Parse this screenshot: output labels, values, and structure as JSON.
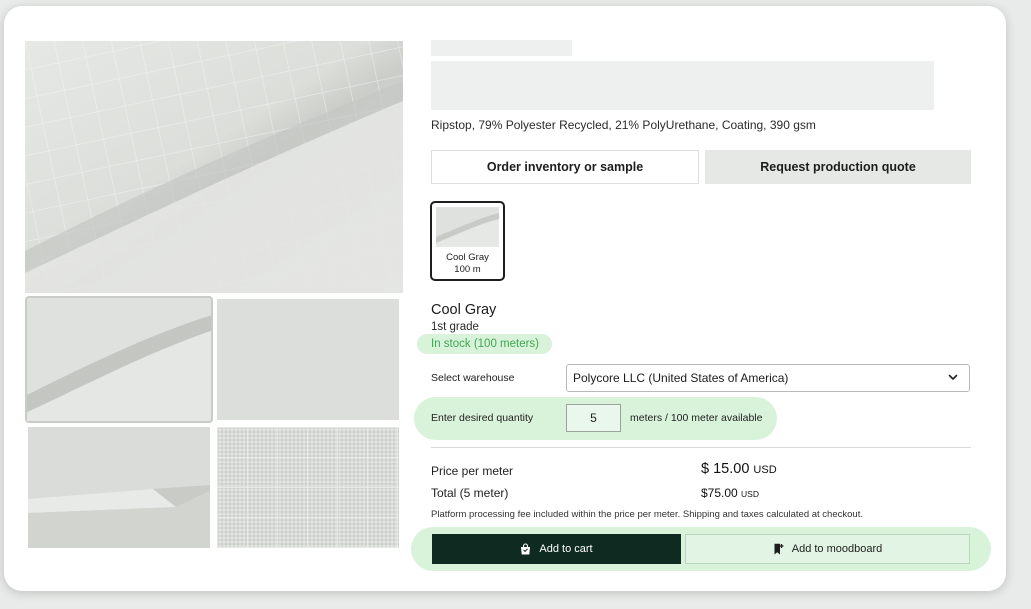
{
  "product": {
    "description": "Ripstop, 79% Polyester Recycled, 21% PolyUrethane, Coating, 390 gsm"
  },
  "tabs": {
    "order_label": "Order inventory or sample",
    "quote_label": "Request production quote"
  },
  "swatch": {
    "name": "Cool Gray",
    "quantity": "100 m",
    "icon": "fabric-swatch"
  },
  "variant": {
    "color_name": "Cool Gray",
    "grade": "1st grade",
    "stock_status": "In stock (100 meters)"
  },
  "warehouse": {
    "label": "Select warehouse",
    "selected": "Polycore LLC (United States of America)",
    "icon": "chevron-down-icon"
  },
  "quantity": {
    "label": "Enter desired quantity",
    "value": "5",
    "availability": "meters / 100 meter available"
  },
  "pricing": {
    "price_label": "Price per meter",
    "price_value": "$ 15.00",
    "price_currency": "USD",
    "total_label": "Total (5 meter)",
    "total_value": "$75.00",
    "total_currency": "USD",
    "fee_note": "Platform processing fee included within the price per meter. Shipping and taxes calculated at checkout."
  },
  "actions": {
    "cart_label": "Add to cart",
    "cart_icon": "shopping-bag-icon",
    "moodboard_label": "Add to moodboard",
    "moodboard_icon": "bookmark-add-icon"
  },
  "colors": {
    "accent_green_bg": "#d9f3db",
    "stock_text": "#3ea853",
    "cart_button_bg": "#0f2a20",
    "swatch_border": "#1e1e1e"
  }
}
